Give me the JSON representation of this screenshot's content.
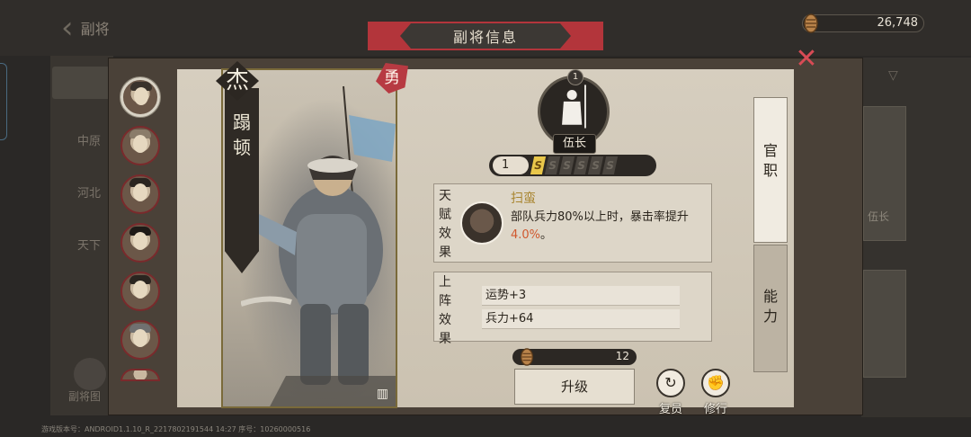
{
  "background": {
    "back_label": "副将",
    "categories": [
      "中原",
      "河北",
      "天下"
    ],
    "recruit_label": "副将图",
    "card_labels": [
      "伍长"
    ],
    "version_text": "游戏版本号：ANDROID1.1.10_R_2217802191544 14:27 序号：10260000516"
  },
  "currency": {
    "amount": "26,748",
    "icon": "grain-icon"
  },
  "dialog": {
    "title": "副将信息",
    "close_icon": "close-icon"
  },
  "hero": {
    "name_chars": [
      "蹋",
      "顿"
    ],
    "grade": "杰",
    "trait": "勇",
    "rank_number": "1",
    "rank_name": "伍长",
    "level": "1",
    "stars": [
      "S",
      "S",
      "S",
      "S",
      "S",
      "S"
    ],
    "stars_filled": 1
  },
  "talent": {
    "tag_chars": [
      "天",
      "赋",
      "效",
      "果"
    ],
    "name": "扫蛮",
    "desc_before": "部队兵力80%以上时，暴击率提升",
    "desc_value": "4.0%",
    "desc_after": "。"
  },
  "deploy": {
    "tag_chars": [
      "上",
      "阵",
      "效",
      "果"
    ],
    "rows": [
      "运势+3",
      "兵力+64"
    ]
  },
  "upgrade": {
    "material_count": "12",
    "button_label": "升级"
  },
  "actions": {
    "reset_label": "复员",
    "train_label": "修行"
  },
  "tabs": {
    "rank_chars": [
      "官",
      "职"
    ],
    "ability_chars": [
      "能",
      "力"
    ]
  },
  "colors": {
    "banner_red": "#b3353b",
    "close_red": "#d84b55",
    "talent_gold": "#a8842e",
    "highlight_orange": "#d0582e",
    "star_gold": "#e9c74a"
  }
}
